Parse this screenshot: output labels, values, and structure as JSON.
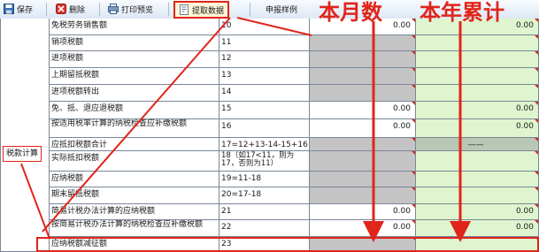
{
  "toolbar": {
    "save": "保存",
    "delete": "删除",
    "print_preview": "打印预览",
    "fetch_data": "提取数据",
    "sample": "申报样例"
  },
  "annotations": {
    "current_month": "本月数",
    "year_total": "本年累计"
  },
  "section_label": "税款计算",
  "rows": [
    {
      "label": "免税劳务销售额",
      "line": "10",
      "month": "0.00",
      "year": "0.00"
    },
    {
      "label": "销项税额",
      "line": "11",
      "month": "",
      "year": ""
    },
    {
      "label": "进项税额",
      "line": "12",
      "month": "",
      "year": ""
    },
    {
      "label": "上期留抵税额",
      "line": "13",
      "month": "",
      "year": ""
    },
    {
      "label": "进项税额转出",
      "line": "14",
      "month": "",
      "year": ""
    },
    {
      "label": "免、抵、退应退税额",
      "line": "15",
      "month": "0.00",
      "year": "0.00"
    },
    {
      "label": "按适用税率计算的纳税检查应补缴税额",
      "line": "16",
      "month": "0.00",
      "year": "0.00"
    },
    {
      "label": "应抵扣税额合计",
      "line": "17=12+13-14-15+16",
      "month": "",
      "year": "——"
    },
    {
      "label": "实际抵扣税额",
      "line": "18（如17<11，则为17，否则为11）",
      "month": "",
      "year": ""
    },
    {
      "label": "应纳税额",
      "line": "19=11-18",
      "month": "",
      "year": ""
    },
    {
      "label": "期末留抵税额",
      "line": "20=17-18",
      "month": "",
      "year": ""
    },
    {
      "label": "简易计税办法计算的应纳税额",
      "line": "21",
      "month": "0.00",
      "year": "0.00"
    },
    {
      "label": "按简易计税办法计算的纳税检查应补缴税额",
      "line": "22",
      "month": "0.00",
      "year": "0.00"
    },
    {
      "label": "应纳税额减征额",
      "line": "23",
      "month": "",
      "year": ""
    }
  ],
  "colors": {
    "accent_red": "#e0251b",
    "year_column": "#dff5cf",
    "locked_cell": "#c4c4c4"
  }
}
